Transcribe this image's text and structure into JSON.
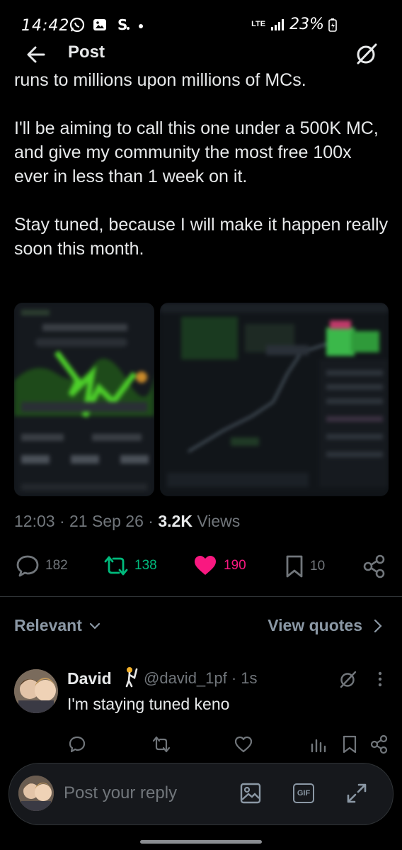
{
  "status_bar": {
    "time": "14:42",
    "network": "LTE",
    "battery": "23%"
  },
  "header": {
    "title": "Post"
  },
  "post": {
    "text": "runs to millions upon millions of MCs.\n\nI'll be aiming to call this one under a 500K MC, and give my community the most free 100x ever in less than 1 week on it.\n\nStay tuned, because I will make it happen really soon this month.",
    "time": "12:03",
    "date": "21 Sep 26",
    "views_count": "3.2K",
    "views_label": "Views",
    "separator": "·"
  },
  "actions": {
    "replies": "182",
    "reposts": "138",
    "likes": "190",
    "bookmarks": "10"
  },
  "sort": {
    "relevant_label": "Relevant",
    "view_quotes_label": "View quotes"
  },
  "reply": {
    "name": "David",
    "handle_time": "@david_1pf · 1s",
    "text": "I'm staying tuned keno"
  },
  "compose": {
    "placeholder": "Post your reply",
    "gif_label": "GIF"
  },
  "colors": {
    "background": "#000000",
    "text": "#e7e9ea",
    "muted": "#71767b",
    "repost": "#00ba7c",
    "like": "#f91880",
    "divider": "#2f3336"
  }
}
